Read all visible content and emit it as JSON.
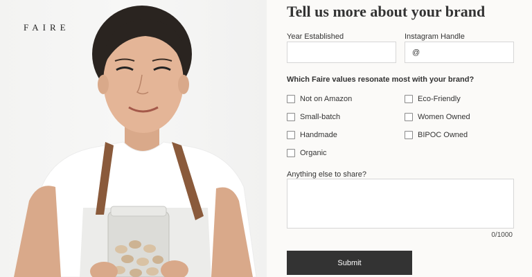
{
  "brand": {
    "logo_text": "FAIRE"
  },
  "photo": {
    "subject": "woman-holding-jar-of-nuts",
    "apron_color": "#8a5a3b",
    "shirt_color": "#ffffff"
  },
  "form": {
    "title": "Tell us more about your brand",
    "year_label": "Year Established",
    "year_value": "",
    "instagram_label": "Instagram Handle",
    "instagram_value": "@",
    "values_question": "Which Faire values resonate most with your brand?",
    "values_options": [
      {
        "label": "Not on Amazon",
        "checked": false
      },
      {
        "label": "Eco-Friendly",
        "checked": false
      },
      {
        "label": "Small-batch",
        "checked": false
      },
      {
        "label": "Women Owned",
        "checked": false
      },
      {
        "label": "Handmade",
        "checked": false
      },
      {
        "label": "BIPOC Owned",
        "checked": false
      },
      {
        "label": "Organic",
        "checked": false
      }
    ],
    "share_label": "Anything else to share?",
    "share_value": "",
    "char_counter": "0/1000",
    "submit_label": "Submit"
  },
  "colors": {
    "button_bg": "#333333",
    "panel_bg": "#fbfaf8",
    "border": "#d6d6d6"
  }
}
